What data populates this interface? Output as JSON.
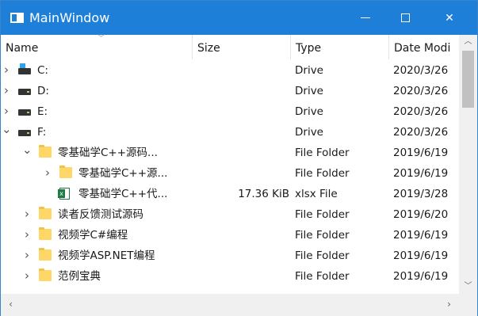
{
  "window": {
    "title": "MainWindow"
  },
  "columns": {
    "name": "Name",
    "size": "Size",
    "type": "Type",
    "date": "Date Modi"
  },
  "rows": [
    {
      "name": "C:",
      "size": "",
      "type": "Drive",
      "date": "2020/3/26",
      "icon": "system-drive-icon",
      "expander": "collapsed",
      "level": 0
    },
    {
      "name": "D:",
      "size": "",
      "type": "Drive",
      "date": "2020/3/26",
      "icon": "drive-icon",
      "expander": "collapsed",
      "level": 0
    },
    {
      "name": "E:",
      "size": "",
      "type": "Drive",
      "date": "2020/3/26",
      "icon": "drive-icon",
      "expander": "collapsed",
      "level": 0
    },
    {
      "name": "F:",
      "size": "",
      "type": "Drive",
      "date": "2020/3/26",
      "icon": "drive-icon",
      "expander": "expanded",
      "level": 0
    },
    {
      "name": "零基础学C++源码...",
      "size": "",
      "type": "File Folder",
      "date": "2019/6/19",
      "icon": "folder-icon",
      "expander": "expanded",
      "level": 1
    },
    {
      "name": "零基础学C++源...",
      "size": "",
      "type": "File Folder",
      "date": "2019/6/19",
      "icon": "folder-icon",
      "expander": "collapsed",
      "level": 2
    },
    {
      "name": "零基础学C++代...",
      "size": "17.36 KiB",
      "type": "xlsx File",
      "date": "2019/3/28",
      "icon": "excel-file-icon",
      "expander": "none",
      "level": 2
    },
    {
      "name": "读者反馈测试源码",
      "size": "",
      "type": "File Folder",
      "date": "2019/6/20",
      "icon": "folder-icon",
      "expander": "collapsed",
      "level": 1
    },
    {
      "name": "视频学C#编程",
      "size": "",
      "type": "File Folder",
      "date": "2019/6/19",
      "icon": "folder-icon",
      "expander": "collapsed",
      "level": 1
    },
    {
      "name": "视频学ASP.NET编程",
      "size": "",
      "type": "File Folder",
      "date": "2019/6/19",
      "icon": "folder-icon",
      "expander": "collapsed",
      "level": 1
    },
    {
      "name": "范例宝典",
      "size": "",
      "type": "File Folder",
      "date": "2019/6/19",
      "icon": "folder-icon",
      "expander": "collapsed",
      "level": 1
    }
  ]
}
